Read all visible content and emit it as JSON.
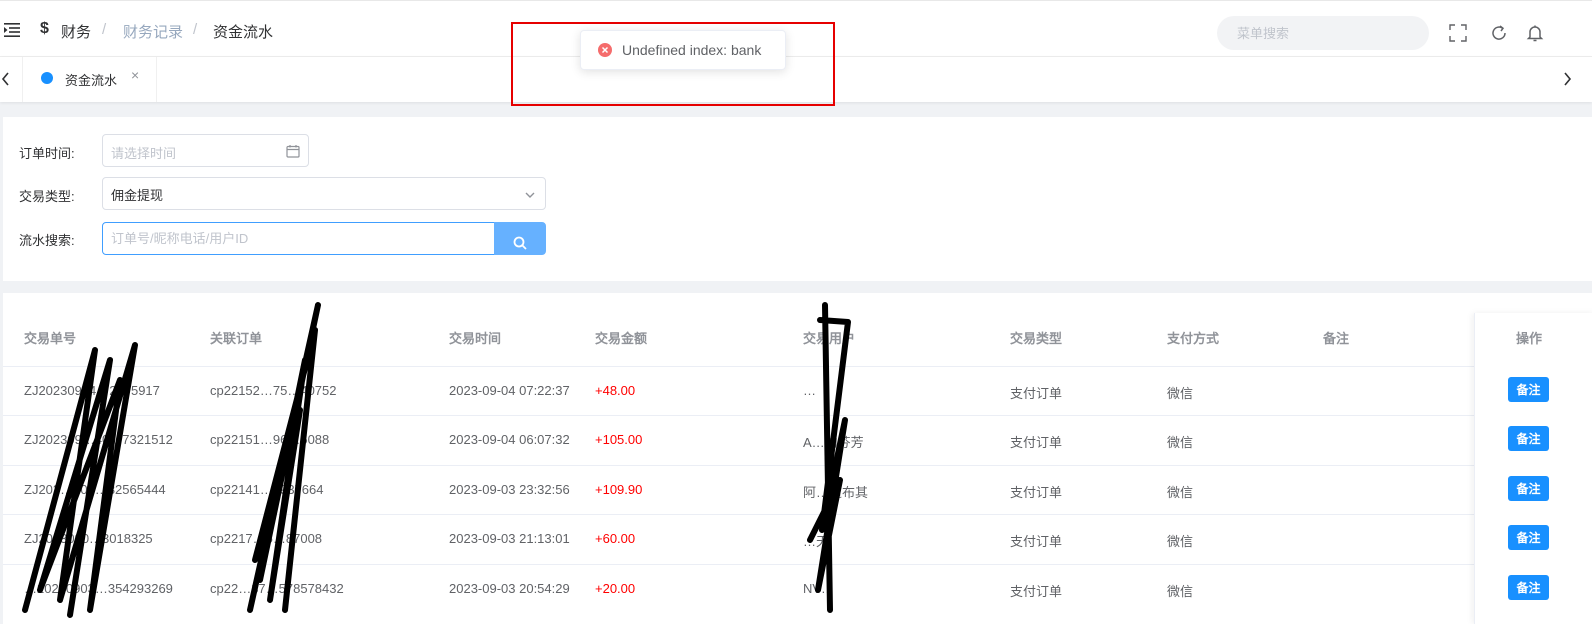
{
  "breadcrumb": {
    "icon": "$",
    "items": [
      "财务",
      "财务记录",
      "资金流水"
    ],
    "separator": "/"
  },
  "header": {
    "menu_search_placeholder": "菜单搜索",
    "icons": [
      "fullscreen-icon",
      "refresh-icon",
      "bell-icon"
    ]
  },
  "tabs": [
    {
      "label": "资金流水",
      "close": "×",
      "active": true
    }
  ],
  "toast": {
    "type": "error",
    "message": "Undefined index: bank",
    "highlight_color": "#e60000"
  },
  "filters": {
    "order_time": {
      "label": "订单时间:",
      "placeholder": "请选择时间"
    },
    "trade_type": {
      "label": "交易类型:",
      "value": "佣金提现"
    },
    "flow_search": {
      "label": "流水搜索:",
      "placeholder": "订单号/昵称电话/用户ID"
    }
  },
  "table": {
    "columns": [
      "交易单号",
      "关联订单",
      "交易时间",
      "交易金额",
      "交易用户",
      "交易类型",
      "支付方式",
      "备注",
      "操作"
    ],
    "rows": [
      {
        "trade_no": "ZJ20230904…2275917",
        "order_no": "cp22152…75…40752",
        "time": "2023-09-04 07:22:37",
        "amount": "+48.00",
        "user": "…",
        "type": "支付订单",
        "pay": "微信",
        "remark": ""
      },
      {
        "trade_no": "ZJ202309…40…7321512",
        "order_no": "cp22151…96…5088",
        "time": "2023-09-04 06:07:32",
        "amount": "+105.00",
        "user": "A…的芬芳",
        "type": "支付订单",
        "pay": "微信",
        "remark": ""
      },
      {
        "trade_no": "ZJ202…903…32565444",
        "order_no": "cp22141…1937664",
        "time": "2023-09-03 23:32:56",
        "amount": "+109.90",
        "user": "阿…道布其",
        "type": "支付订单",
        "pay": "微信",
        "remark": ""
      },
      {
        "trade_no": "ZJ2023090…3018325",
        "order_no": "cp2217…5…87008",
        "time": "2023-09-03 21:13:01",
        "amount": "+60.00",
        "user": "…天",
        "type": "支付订单",
        "pay": "微信",
        "remark": ""
      },
      {
        "trade_no": "…20230903…354293269",
        "order_no": "cp22…37…578578432",
        "time": "2023-09-03 20:54:29",
        "amount": "+20.00",
        "user": "NV…",
        "type": "支付订单",
        "pay": "微信",
        "remark": ""
      }
    ],
    "action_label": "备注"
  },
  "colors": {
    "primary": "#1890ff",
    "amount": "#ff0000",
    "error": "#f56c6c"
  }
}
